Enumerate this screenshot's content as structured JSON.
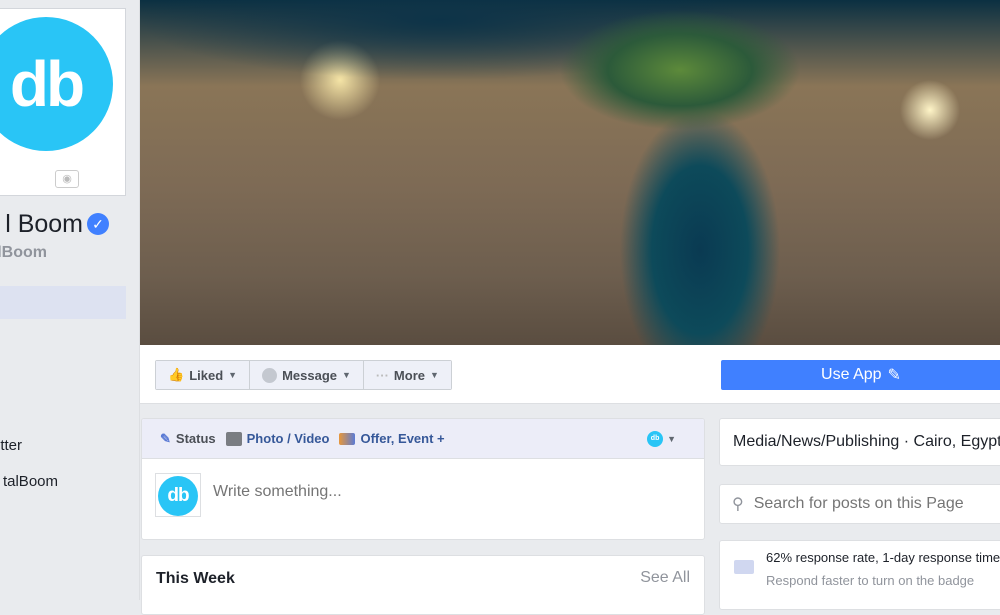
{
  "page": {
    "name": "l Boom",
    "handle": "lBoom",
    "logo_text": "db",
    "verified": true
  },
  "left_nav": {
    "items": [
      {
        "label": "tter"
      },
      {
        "label": "talBoom"
      }
    ]
  },
  "actions": {
    "liked": "Liked",
    "message": "Message",
    "more": "More",
    "use_app": "Use App"
  },
  "composer": {
    "tabs": {
      "status": "Status",
      "photo": "Photo / Video",
      "offer": "Offer, Event +"
    },
    "placeholder": "Write something...",
    "avatar_text": "db"
  },
  "this_week": {
    "title": "This Week",
    "see_all": "See All"
  },
  "about": {
    "category": "Media/News/Publishing · Cairo, Egypt"
  },
  "search": {
    "placeholder": "Search for posts on this Page"
  },
  "response": {
    "rate": "62% response rate, 1-day response time",
    "hint": "Respond faster to turn on the badge"
  },
  "colors": {
    "brand": "#29c5f6",
    "primary": "#4080ff",
    "link": "#365899"
  }
}
